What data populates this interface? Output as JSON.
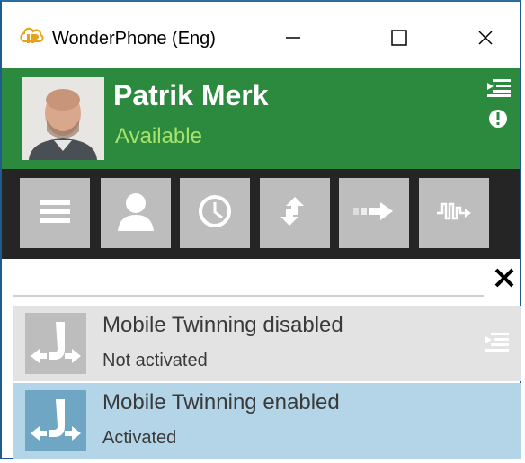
{
  "window": {
    "title": "WonderPhone (Eng)"
  },
  "profile": {
    "name": "Patrik Merk",
    "status": "Available",
    "status_color": "#a6e36b",
    "header_color": "#2b8a3e"
  },
  "toolbar": {
    "buttons": [
      {
        "icon": "hamburger-menu-icon"
      },
      {
        "icon": "contacts-person-icon"
      },
      {
        "icon": "history-clock-icon"
      },
      {
        "icon": "transfer-arrows-icon"
      },
      {
        "icon": "forward-arrow-icon"
      },
      {
        "icon": "voicemail-wave-icon"
      }
    ]
  },
  "search": {
    "value": "",
    "placeholder": ""
  },
  "list": {
    "items": [
      {
        "title": "Mobile Twinning disabled",
        "subtitle": "Not activated",
        "state": "inactive"
      },
      {
        "title": "Mobile Twinning enabled",
        "subtitle": "Activated",
        "state": "active"
      }
    ]
  }
}
